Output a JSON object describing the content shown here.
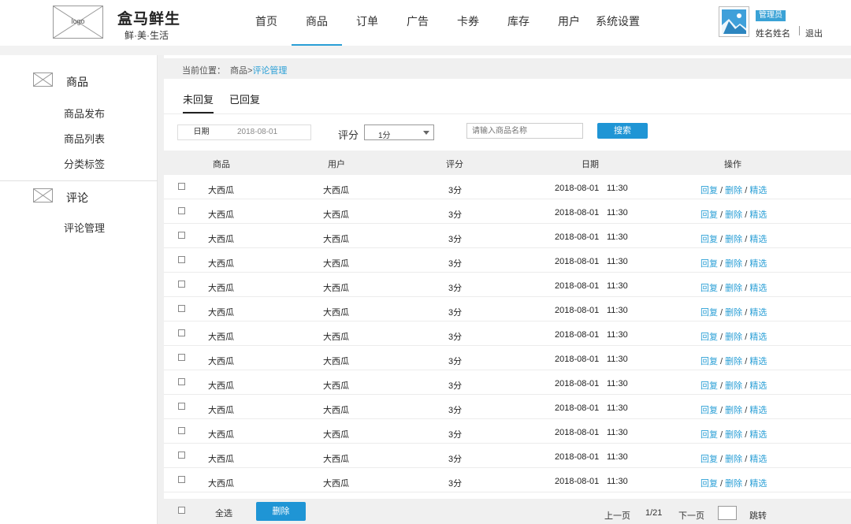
{
  "header": {
    "logo_text": "logo",
    "brand_name": "盒马鲜生",
    "brand_slogan": "鲜·美·生活",
    "nav": [
      {
        "label": "首页",
        "name": "nav-home"
      },
      {
        "label": "商品",
        "name": "nav-products",
        "active": true
      },
      {
        "label": "订单",
        "name": "nav-orders"
      },
      {
        "label": "广告",
        "name": "nav-ads"
      },
      {
        "label": "卡券",
        "name": "nav-coupons"
      },
      {
        "label": "库存",
        "name": "nav-inventory"
      },
      {
        "label": "用户",
        "name": "nav-users"
      },
      {
        "label": "系统设置",
        "name": "nav-settings"
      }
    ],
    "role_badge": "管理员",
    "user_name": "姓名姓名",
    "logout_label": "退出"
  },
  "sidebar": {
    "groups": [
      {
        "title": "商品",
        "icon": "image-placeholder-icon",
        "items": [
          "商品发布",
          "商品列表",
          "分类标签"
        ]
      },
      {
        "title": "评论",
        "icon": "image-placeholder-icon",
        "items": [
          "评论管理"
        ]
      }
    ]
  },
  "breadcrumb": {
    "label": "当前位置：",
    "parent": "商品>",
    "current": "评论管理"
  },
  "tabs": [
    {
      "label": "未回复",
      "active": true
    },
    {
      "label": "已回复",
      "active": false
    }
  ],
  "filters": {
    "date_label": "日期",
    "date_value": "2018-08-01",
    "rating_label": "评分",
    "rating_value": "1分",
    "search_placeholder": "请输入商品名称",
    "search_button": "搜索"
  },
  "table": {
    "columns": [
      "商品",
      "用户",
      "评分",
      "日期",
      "操作"
    ],
    "rows": [
      {
        "product": "大西瓜",
        "user": "大西瓜",
        "rating": "3分",
        "date": "2018-08-01",
        "time": "11:30"
      },
      {
        "product": "大西瓜",
        "user": "大西瓜",
        "rating": "3分",
        "date": "2018-08-01",
        "time": "11:30"
      },
      {
        "product": "大西瓜",
        "user": "大西瓜",
        "rating": "3分",
        "date": "2018-08-01",
        "time": "11:30"
      },
      {
        "product": "大西瓜",
        "user": "大西瓜",
        "rating": "3分",
        "date": "2018-08-01",
        "time": "11:30"
      },
      {
        "product": "大西瓜",
        "user": "大西瓜",
        "rating": "3分",
        "date": "2018-08-01",
        "time": "11:30"
      },
      {
        "product": "大西瓜",
        "user": "大西瓜",
        "rating": "3分",
        "date": "2018-08-01",
        "time": "11:30"
      },
      {
        "product": "大西瓜",
        "user": "大西瓜",
        "rating": "3分",
        "date": "2018-08-01",
        "time": "11:30"
      },
      {
        "product": "大西瓜",
        "user": "大西瓜",
        "rating": "3分",
        "date": "2018-08-01",
        "time": "11:30"
      },
      {
        "product": "大西瓜",
        "user": "大西瓜",
        "rating": "3分",
        "date": "2018-08-01",
        "time": "11:30"
      },
      {
        "product": "大西瓜",
        "user": "大西瓜",
        "rating": "3分",
        "date": "2018-08-01",
        "time": "11:30"
      },
      {
        "product": "大西瓜",
        "user": "大西瓜",
        "rating": "3分",
        "date": "2018-08-01",
        "time": "11:30"
      },
      {
        "product": "大西瓜",
        "user": "大西瓜",
        "rating": "3分",
        "date": "2018-08-01",
        "time": "11:30"
      },
      {
        "product": "大西瓜",
        "user": "大西瓜",
        "rating": "3分",
        "date": "2018-08-01",
        "time": "11:30"
      }
    ],
    "actions": {
      "reply": "回复",
      "delete": "删除",
      "feature": "精选",
      "separator": " / "
    }
  },
  "footer": {
    "select_all": "全选",
    "delete_button": "删除",
    "prev_page": "上一页",
    "page_info": "1/21",
    "next_page": "下一页",
    "jump_label": "跳转"
  },
  "colors": {
    "accent": "#1f95d5",
    "link": "#2a9fd6"
  }
}
